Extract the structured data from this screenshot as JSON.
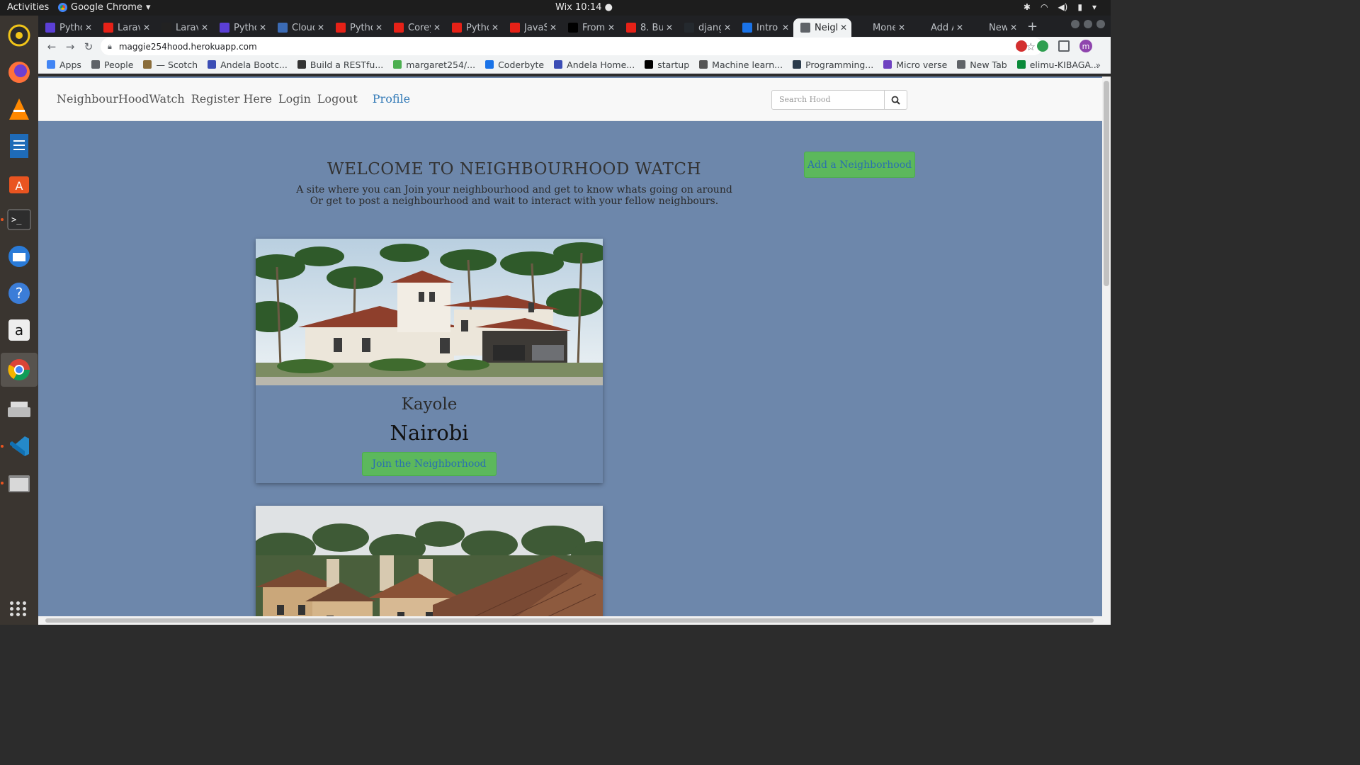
{
  "system_bar": {
    "activities": "Activities",
    "app_name": "Google Chrome",
    "app_menu_arrow": "▾",
    "clock": "Wix 10:14 ●",
    "tray_icons": [
      "bluetooth-icon",
      "wifi-icon",
      "volume-icon",
      "battery-icon",
      "power-menu-icon"
    ]
  },
  "dock": {
    "apps": [
      "rhythmbox-icon",
      "firefox-icon",
      "vlc-icon",
      "writer-icon",
      "software-center-icon",
      "terminal-icon",
      "thunderbird-icon",
      "help-icon",
      "amazon-icon",
      "chrome-icon",
      "scanner-icon",
      "vscode-icon",
      "files-icon"
    ],
    "show_apps": "show-applications-icon"
  },
  "tabs": [
    {
      "label": "Pytho",
      "fav_color": "#5b3fd6"
    },
    {
      "label": "Larav",
      "fav_color": "#e62117"
    },
    {
      "label": "Larav",
      "fav_color": "#222222"
    },
    {
      "label": "Pytho",
      "fav_color": "#5b3fd6"
    },
    {
      "label": "Cloud",
      "fav_color": "#3b6bb5"
    },
    {
      "label": "Pytho",
      "fav_color": "#e62117"
    },
    {
      "label": "Corey",
      "fav_color": "#e62117"
    },
    {
      "label": "Pytho",
      "fav_color": "#e62117"
    },
    {
      "label": "JavaS",
      "fav_color": "#e62117"
    },
    {
      "label": "From",
      "fav_color": "#000000"
    },
    {
      "label": "8. Bu",
      "fav_color": "#e62117"
    },
    {
      "label": "djang",
      "fav_color": "#24292e"
    },
    {
      "label": "Intro",
      "fav_color": "#1a73e8"
    },
    {
      "label": "Neigl",
      "fav_color": "#5f6368",
      "active": true
    },
    {
      "label": "Mone",
      "fav_color": "#202124"
    },
    {
      "label": "Add A",
      "fav_color": "#202124"
    },
    {
      "label": "New Tab",
      "fav_color": "#202124"
    }
  ],
  "omnibox": {
    "url": "maggie254hood.herokuapp.com"
  },
  "bookmarks": [
    {
      "label": "Apps",
      "color": "#4285f4"
    },
    {
      "label": "People",
      "color": "#5f6368"
    },
    {
      "label": "— Scotch",
      "color": "#8a6d3b"
    },
    {
      "label": "Andela Bootc...",
      "color": "#3b4db5"
    },
    {
      "label": "Build a RESTfu...",
      "color": "#333333"
    },
    {
      "label": "margaret254/...",
      "color": "#4caf50"
    },
    {
      "label": "Coderbyte",
      "color": "#1a73e8"
    },
    {
      "label": "Andela Home...",
      "color": "#3b4db5"
    },
    {
      "label": "startup",
      "color": "#000000"
    },
    {
      "label": "Machine learn...",
      "color": "#555555"
    },
    {
      "label": "Programming...",
      "color": "#2b3b4b"
    },
    {
      "label": "Micro verse",
      "color": "#6f42c1"
    },
    {
      "label": "New Tab",
      "color": "#5f6368"
    },
    {
      "label": "elimu-KIBAGA...",
      "color": "#0a8a3a"
    }
  ],
  "site": {
    "nav": {
      "brand": "NeighbourHoodWatch",
      "register": "Register Here",
      "login": "Login",
      "logout": "Logout",
      "profile": "Profile"
    },
    "search_placeholder": "Search Hood",
    "add_button": "Add a Neighborhood",
    "welcome_title": "WELCOME TO NEIGHBOURHOOD WATCH",
    "welcome_line1": "A site where you can Join your neighbourhood and get to know whats going on around",
    "welcome_line2": "Or get to post a neighbourhood and wait to interact with your fellow neighbours.",
    "hoods": [
      {
        "name": "Kayole",
        "city": "Nairobi",
        "join": "Join the Neighborhood"
      }
    ]
  }
}
